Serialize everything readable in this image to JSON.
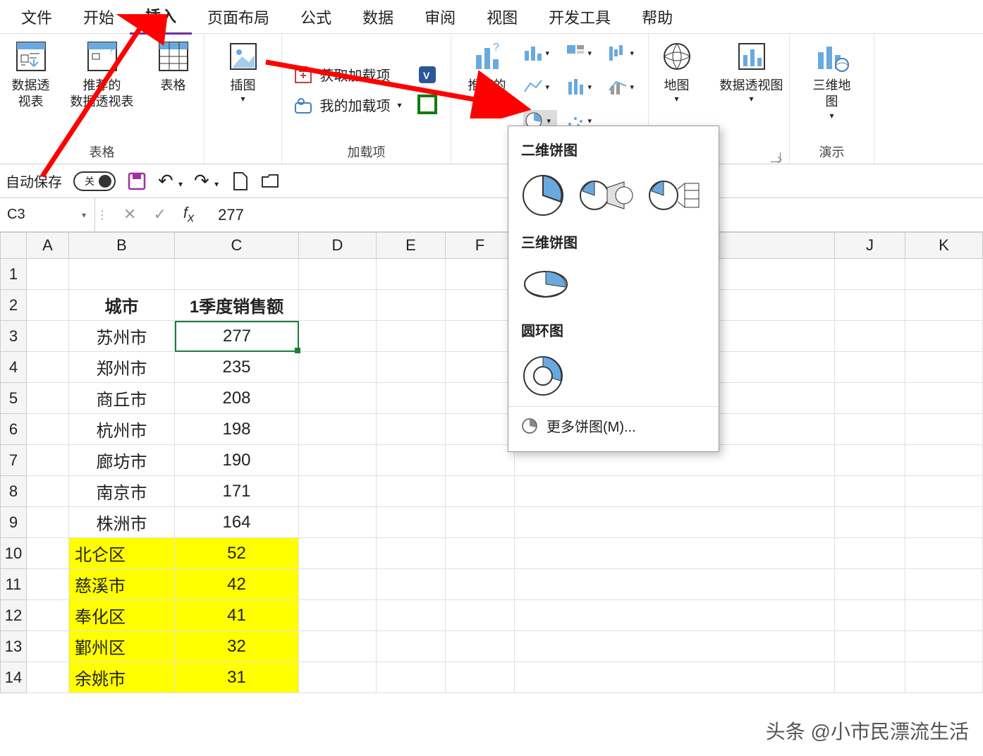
{
  "tabs": [
    "文件",
    "开始",
    "插入",
    "页面布局",
    "公式",
    "数据",
    "审阅",
    "视图",
    "开发工具",
    "帮助"
  ],
  "active_tab_index": 2,
  "ribbon": {
    "group_tables_label": "表格",
    "btn_pivot": "数据透\n视表",
    "btn_rec_pivot": "推荐的\n数据透视表",
    "btn_table": "表格",
    "group_illust": "插图",
    "btn_illust": "插图",
    "group_addins_label": "加载项",
    "btn_getaddin": "获取加载项",
    "btn_myaddin": "我的加载项",
    "group_charts_left": "推荐的\n图表",
    "btn_map": "地图",
    "btn_pivotchart": "数据透视图",
    "group_tour_label": "演示",
    "btn_3dmap": "三维地\n图"
  },
  "qat": {
    "autosave": "自动保存",
    "autosave_state": "关"
  },
  "fx": {
    "namebox": "C3",
    "value": "277"
  },
  "columns_left": [
    "A",
    "B",
    "C",
    "D",
    "E",
    "F"
  ],
  "columns_right": [
    "J",
    "K"
  ],
  "row_numbers": [
    "1",
    "2",
    "3",
    "4",
    "5",
    "6",
    "7",
    "8",
    "9",
    "10",
    "11",
    "12",
    "13",
    "14"
  ],
  "headers": {
    "city": "城市",
    "sales": "1季度销售额"
  },
  "data_rows": [
    {
      "city": "苏州市",
      "val": "277",
      "hl": false,
      "sel": true
    },
    {
      "city": "郑州市",
      "val": "235",
      "hl": false
    },
    {
      "city": "商丘市",
      "val": "208",
      "hl": false
    },
    {
      "city": "杭州市",
      "val": "198",
      "hl": false
    },
    {
      "city": "廊坊市",
      "val": "190",
      "hl": false
    },
    {
      "city": "南京市",
      "val": "171",
      "hl": false
    },
    {
      "city": "株洲市",
      "val": "164",
      "hl": false
    },
    {
      "city": "北仑区",
      "val": "52",
      "hl": true
    },
    {
      "city": "慈溪市",
      "val": "42",
      "hl": true
    },
    {
      "city": "奉化区",
      "val": "41",
      "hl": true
    },
    {
      "city": "鄞州区",
      "val": "32",
      "hl": true
    },
    {
      "city": "余姚市",
      "val": "31",
      "hl": true
    }
  ],
  "dropdown": {
    "sec1": "二维饼图",
    "sec2": "三维饼图",
    "sec3": "圆环图",
    "more": "更多饼图(M)..."
  },
  "watermark": "头条 @小市民漂流生活",
  "colors": {
    "accent": "#6aa9de",
    "outline": "#3a3a3a",
    "sel": "#1a7f37",
    "hl": "#ffff00",
    "purple": "#7030a0",
    "arrow": "#ff0000"
  }
}
